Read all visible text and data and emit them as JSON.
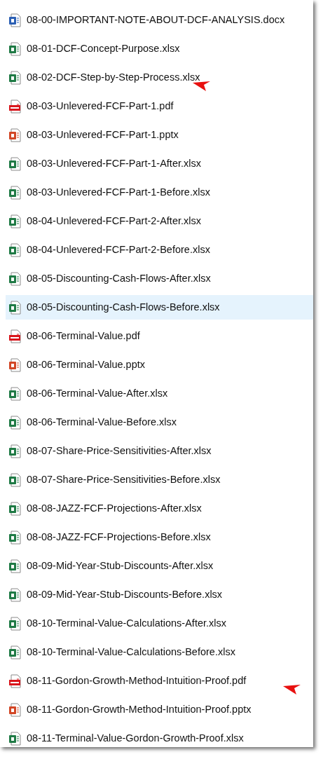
{
  "files": [
    {
      "name": "08-00-IMPORTANT-NOTE-ABOUT-DCF-ANALYSIS.docx",
      "kind": "word",
      "selected": false,
      "arrow": false
    },
    {
      "name": "08-01-DCF-Concept-Purpose.xlsx",
      "kind": "excel",
      "selected": false,
      "arrow": false
    },
    {
      "name": "08-02-DCF-Step-by-Step-Process.xlsx",
      "kind": "excel",
      "selected": false,
      "arrow": true
    },
    {
      "name": "08-03-Unlevered-FCF-Part-1.pdf",
      "kind": "pdf",
      "selected": false,
      "arrow": false
    },
    {
      "name": "08-03-Unlevered-FCF-Part-1.pptx",
      "kind": "powerpoint",
      "selected": false,
      "arrow": false
    },
    {
      "name": "08-03-Unlevered-FCF-Part-1-After.xlsx",
      "kind": "excel",
      "selected": false,
      "arrow": false
    },
    {
      "name": "08-03-Unlevered-FCF-Part-1-Before.xlsx",
      "kind": "excel",
      "selected": false,
      "arrow": false
    },
    {
      "name": "08-04-Unlevered-FCF-Part-2-After.xlsx",
      "kind": "excel",
      "selected": false,
      "arrow": false
    },
    {
      "name": "08-04-Unlevered-FCF-Part-2-Before.xlsx",
      "kind": "excel",
      "selected": false,
      "arrow": false
    },
    {
      "name": "08-05-Discounting-Cash-Flows-After.xlsx",
      "kind": "excel",
      "selected": false,
      "arrow": false
    },
    {
      "name": "08-05-Discounting-Cash-Flows-Before.xlsx",
      "kind": "excel",
      "selected": true,
      "arrow": false
    },
    {
      "name": "08-06-Terminal-Value.pdf",
      "kind": "pdf",
      "selected": false,
      "arrow": false
    },
    {
      "name": "08-06-Terminal-Value.pptx",
      "kind": "powerpoint",
      "selected": false,
      "arrow": false
    },
    {
      "name": "08-06-Terminal-Value-After.xlsx",
      "kind": "excel",
      "selected": false,
      "arrow": false
    },
    {
      "name": "08-06-Terminal-Value-Before.xlsx",
      "kind": "excel",
      "selected": false,
      "arrow": false
    },
    {
      "name": "08-07-Share-Price-Sensitivities-After.xlsx",
      "kind": "excel",
      "selected": false,
      "arrow": false
    },
    {
      "name": "08-07-Share-Price-Sensitivities-Before.xlsx",
      "kind": "excel",
      "selected": false,
      "arrow": false
    },
    {
      "name": "08-08-JAZZ-FCF-Projections-After.xlsx",
      "kind": "excel",
      "selected": false,
      "arrow": false
    },
    {
      "name": "08-08-JAZZ-FCF-Projections-Before.xlsx",
      "kind": "excel",
      "selected": false,
      "arrow": false
    },
    {
      "name": "08-09-Mid-Year-Stub-Discounts-After.xlsx",
      "kind": "excel",
      "selected": false,
      "arrow": false
    },
    {
      "name": "08-09-Mid-Year-Stub-Discounts-Before.xlsx",
      "kind": "excel",
      "selected": false,
      "arrow": false
    },
    {
      "name": "08-10-Terminal-Value-Calculations-After.xlsx",
      "kind": "excel",
      "selected": false,
      "arrow": false
    },
    {
      "name": "08-10-Terminal-Value-Calculations-Before.xlsx",
      "kind": "excel",
      "selected": false,
      "arrow": false
    },
    {
      "name": "08-11-Gordon-Growth-Method-Intuition-Proof.pdf",
      "kind": "pdf",
      "selected": false,
      "arrow": true
    },
    {
      "name": "08-11-Gordon-Growth-Method-Intuition-Proof.pptx",
      "kind": "powerpoint",
      "selected": false,
      "arrow": false
    },
    {
      "name": "08-11-Terminal-Value-Gordon-Growth-Proof.xlsx",
      "kind": "excel",
      "selected": false,
      "arrow": false
    }
  ]
}
